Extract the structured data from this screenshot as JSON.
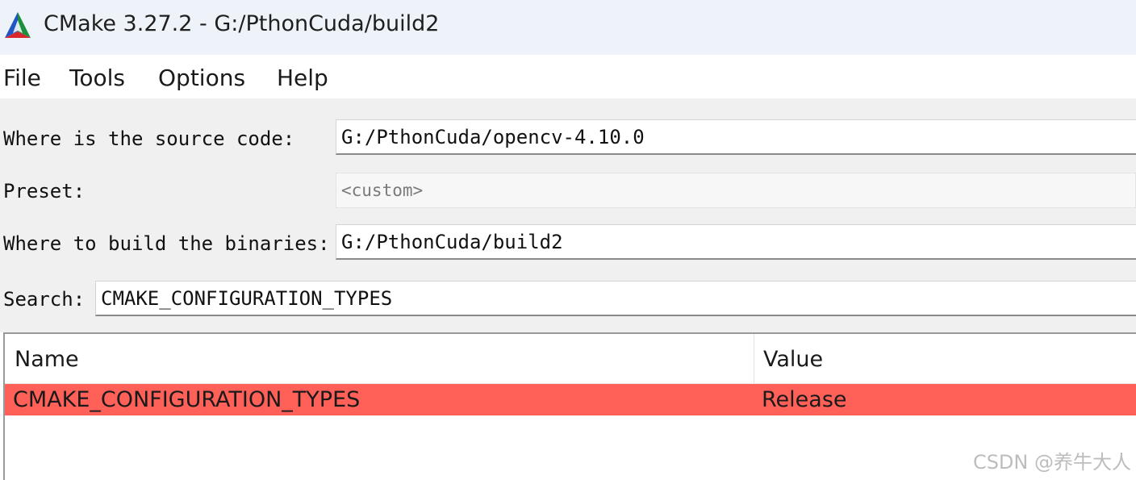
{
  "window": {
    "title": "CMake 3.27.2 - G:/PthonCuda/build2",
    "icon": "cmake-triangle-logo"
  },
  "menu": {
    "items": [
      "File",
      "Tools",
      "Options",
      "Help"
    ]
  },
  "form": {
    "source_label": "Where is the source code:",
    "source_value": "G:/PthonCuda/opencv-4.10.0",
    "preset_label": "Preset:",
    "preset_value": "<custom>",
    "binaries_label": "Where to build the binaries:",
    "binaries_value": "G:/PthonCuda/build2",
    "search_label": "Search:",
    "search_value": "CMAKE_CONFIGURATION_TYPES"
  },
  "table": {
    "columns": [
      "Name",
      "Value"
    ],
    "rows": [
      {
        "name": "CMAKE_CONFIGURATION_TYPES",
        "value": "Release",
        "highlight_color": "#ff6159"
      }
    ]
  },
  "watermark": "CSDN @养牛大人"
}
